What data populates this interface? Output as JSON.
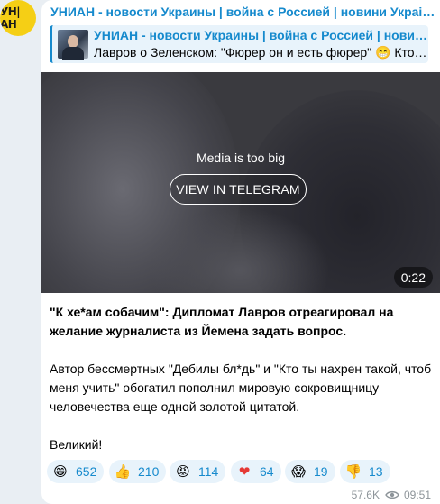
{
  "channel": {
    "avatar_text": "УН|АН",
    "name": "УНИАН - новости Украины | война с Россией | новини Украіни | війна з Р"
  },
  "reply": {
    "title": "УНИАН - новости Украины | война с Россией | новини Украіни | війна з Росією",
    "text": "Лавров о Зеленском: \"Фюрер он и есть фюрер\" 😁 Кто не в курсе, давно известно"
  },
  "media": {
    "caption": "Media is too big",
    "button_label": "VIEW IN TELEGRAM",
    "duration": "0:22"
  },
  "message": {
    "headline": "\"К хе*ам собачим\": Дипломат Лавров отреагировал на желание журналиста из Йемена задать вопрос.",
    "body": "Автор бессмертных \"Дебилы бл*дь\" и \"Кто ты нахрен такой, чтоб меня учить\" обогатил пополнил мировую сокровищницу человечества еще одной золотой цитатой.",
    "closing": "Великий!"
  },
  "reactions": [
    {
      "emoji": "😁",
      "count": "652"
    },
    {
      "emoji": "👍",
      "count": "210"
    },
    {
      "emoji": "😡",
      "count": "114"
    },
    {
      "emoji": "❤",
      "count": "64"
    },
    {
      "emoji": "😱",
      "count": "19"
    },
    {
      "emoji": "👎",
      "count": "13"
    }
  ],
  "meta": {
    "views": "57.6K",
    "time": "09:51"
  },
  "colors": {
    "accent": "#168acd",
    "reaction_bg": "#e8f3fb",
    "avatar_bg": "#f5cf15",
    "page_bg": "#e9eef3"
  }
}
